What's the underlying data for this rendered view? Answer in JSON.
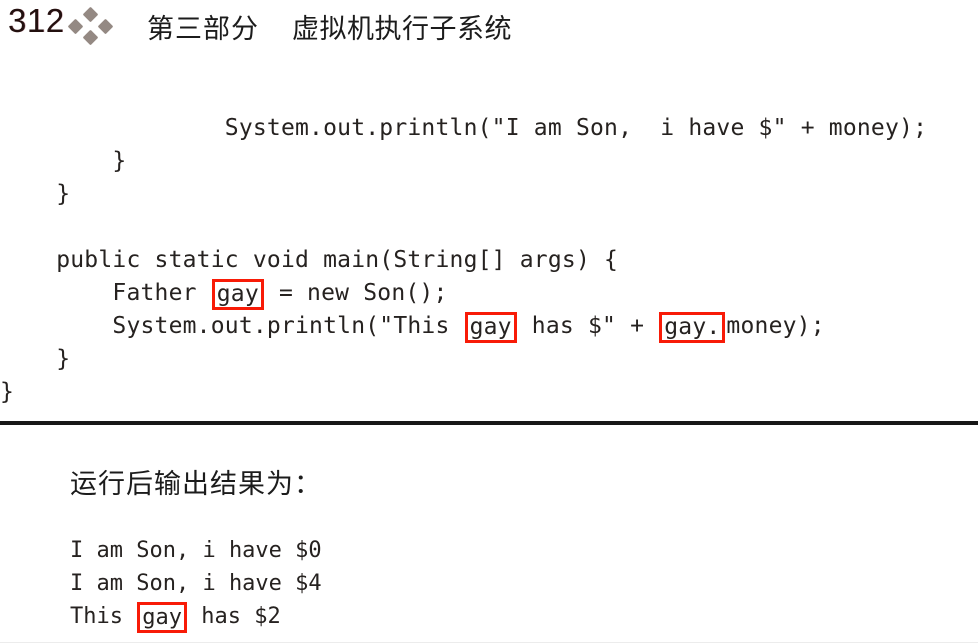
{
  "header": {
    "page_number": "312",
    "ornament_icon": "four-diamond-ornament",
    "part_label": "第三部分",
    "section_title": "虚拟机执行子系统"
  },
  "code": {
    "lines": [
      {
        "indent": "                ",
        "segments": [
          {
            "text": "System.out.println(\"I am Son,  i have $\" + money);",
            "boxed": false
          }
        ]
      },
      {
        "indent": "        ",
        "segments": [
          {
            "text": "}",
            "boxed": false
          }
        ]
      },
      {
        "indent": "    ",
        "segments": [
          {
            "text": "}",
            "boxed": false
          }
        ]
      },
      {
        "indent": "",
        "segments": [
          {
            "text": "",
            "boxed": false
          }
        ]
      },
      {
        "indent": "    ",
        "segments": [
          {
            "text": "public static void main(String[] args) {",
            "boxed": false
          }
        ]
      },
      {
        "indent": "        ",
        "segments": [
          {
            "text": "Father ",
            "boxed": false
          },
          {
            "text": "gay",
            "boxed": true
          },
          {
            "text": " = new Son();",
            "boxed": false
          }
        ]
      },
      {
        "indent": "        ",
        "segments": [
          {
            "text": "System.out.println(\"This ",
            "boxed": false
          },
          {
            "text": "gay",
            "boxed": true
          },
          {
            "text": " has $\" + ",
            "boxed": false
          },
          {
            "text": "gay.",
            "boxed": true
          },
          {
            "text": "money);",
            "boxed": false
          }
        ]
      },
      {
        "indent": "    ",
        "segments": [
          {
            "text": "}",
            "boxed": false
          }
        ]
      },
      {
        "indent": "",
        "segments": [
          {
            "text": "}",
            "boxed": false
          }
        ]
      }
    ]
  },
  "output": {
    "heading": "运行后输出结果为：",
    "lines": [
      {
        "segments": [
          {
            "text": "I am Son, i have $0",
            "boxed": false
          }
        ]
      },
      {
        "segments": [
          {
            "text": "I am Son, i have $4",
            "boxed": false
          }
        ]
      },
      {
        "segments": [
          {
            "text": "This ",
            "boxed": false
          },
          {
            "text": "gay",
            "boxed": true
          },
          {
            "text": " has $2",
            "boxed": false
          }
        ]
      }
    ]
  },
  "colors": {
    "annotation_box": "#f81b07",
    "page_number": "#23100f",
    "body_text": "#262220",
    "rule": "#171717",
    "ornament": "#8b7f78",
    "background": "#ffffff"
  }
}
